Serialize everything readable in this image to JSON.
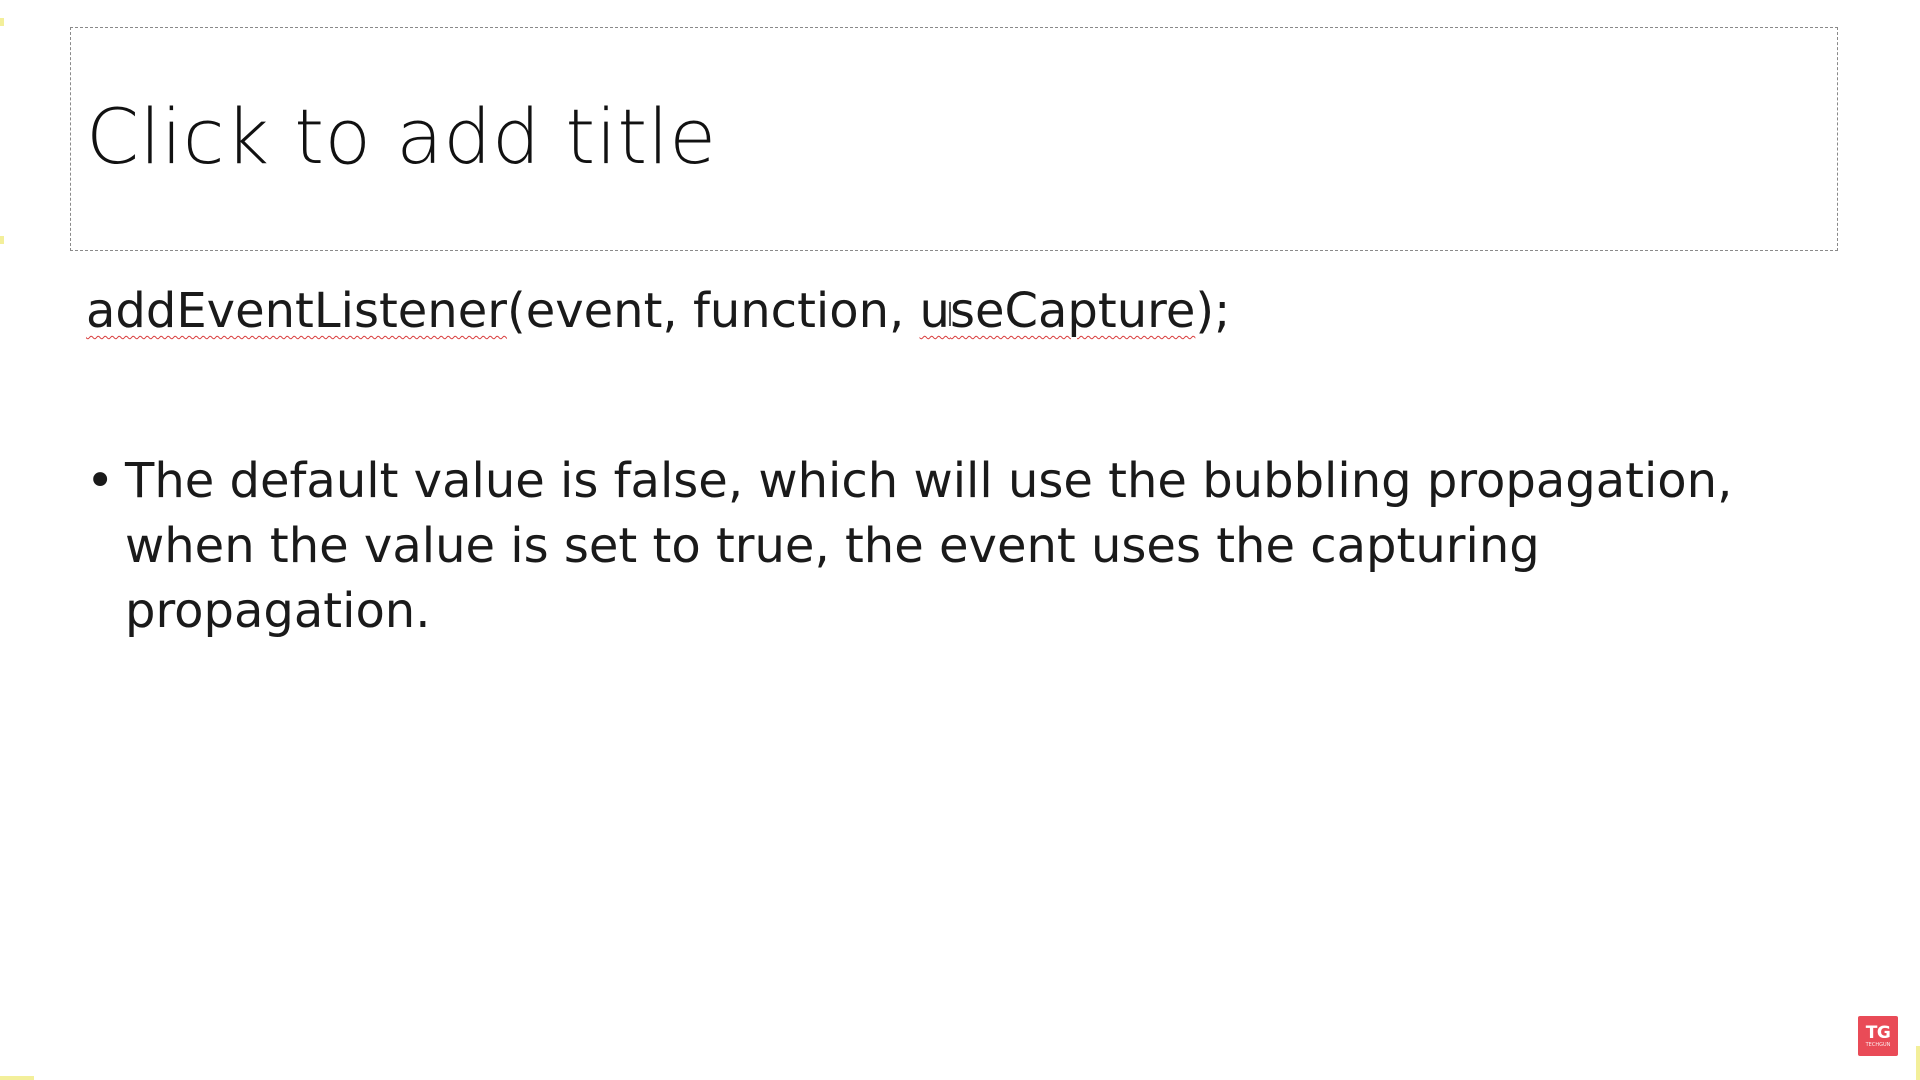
{
  "slide": {
    "title_placeholder": "Click to add title",
    "code": {
      "fn_name": "addEventListener",
      "open_and_args": "(event, function, ",
      "arg_before_cursor": "u",
      "arg_after_cursor": "seCapture",
      "close": ");"
    },
    "bullets": [
      {
        "marker": "•",
        "text": "The default value is false, which will use the bubbling propagation, when the value is set to true, the event uses the capturing propagation."
      }
    ]
  },
  "logo": {
    "main": "TG",
    "sub": "TECHGUN"
  },
  "colors": {
    "logo_background": "#e94b57",
    "spellcheck_underline": "#d83b3b",
    "placeholder_border": "#8a8a8a"
  }
}
